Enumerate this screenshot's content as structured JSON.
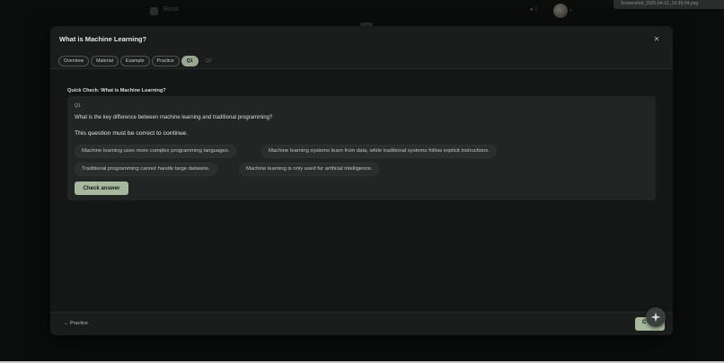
{
  "background": {
    "brand": "Roxa",
    "streak": "0",
    "file_label": "Screenshot_2025-04-12_19-39-04.png"
  },
  "modal": {
    "title": "What is Machine Learning?",
    "tabs": [
      {
        "label": "Overview"
      },
      {
        "label": "Material"
      },
      {
        "label": "Example"
      },
      {
        "label": "Practice"
      },
      {
        "label": "Q1"
      },
      {
        "label": "Q2"
      }
    ],
    "active_tab": "Q1",
    "section_title": "Quick Check: What is Machine Learning?",
    "question": {
      "number": "Q1",
      "text": "What is the key difference between machine learning and traditional programming?",
      "note": "This question must be correct to continue.",
      "options": [
        "Machine learning uses more complex programming languages.",
        "Machine learning systems learn from data, while traditional systems follow explicit instructions.",
        "Traditional programming cannot handle large datasets.",
        "Machine learning is only used for artificial intelligence."
      ],
      "check_label": "Check answer"
    },
    "footer": {
      "back_label": "← Practice",
      "continue_label": "C"
    }
  },
  "colors": {
    "accent": "#a6b99d",
    "background": "#0b0d0c",
    "modal": "#141715",
    "card": "#212523"
  }
}
